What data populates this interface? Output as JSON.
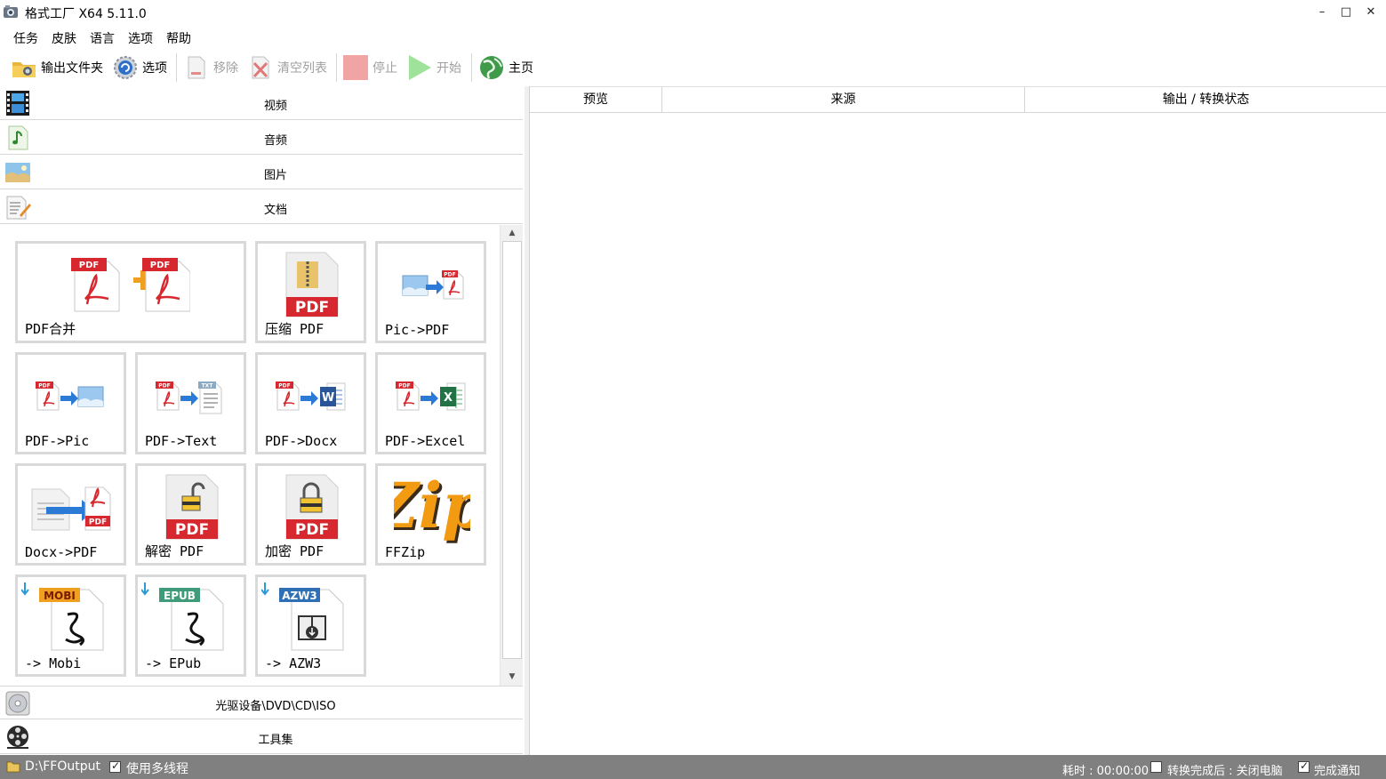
{
  "window": {
    "title": "格式工厂 X64 5.11.0"
  },
  "menu": [
    "任务",
    "皮肤",
    "语言",
    "选项",
    "帮助"
  ],
  "toolbar": {
    "output_folder": "输出文件夹",
    "options": "选项",
    "remove": "移除",
    "clear_list": "清空列表",
    "stop": "停止",
    "start": "开始",
    "home": "主页"
  },
  "categories": {
    "video": "视频",
    "audio": "音频",
    "picture": "图片",
    "document": "文档",
    "rom": "光驱设备\\DVD\\CD\\ISO",
    "tools": "工具集"
  },
  "tiles": {
    "pdf_merge": "PDF合并",
    "pdf_compress": "压缩 PDF",
    "pic_to_pdf": "Pic->PDF",
    "pdf_to_pic": "PDF->Pic",
    "pdf_to_text": "PDF->Text",
    "pdf_to_docx": "PDF->Docx",
    "pdf_to_excel": "PDF->Excel",
    "docx_to_pdf": "Docx->PDF",
    "pdf_decrypt": "解密 PDF",
    "pdf_encrypt": "加密 PDF",
    "ffzip": "FFZip",
    "to_mobi": "-> Mobi",
    "to_epub": "-> EPub",
    "to_azw3": "-> AZW3"
  },
  "art_text": {
    "pdf": "PDF",
    "txt": "TXT",
    "word": "W",
    "excel": "X",
    "zip": "Zip",
    "mobi": "MOBI",
    "epub": "EPUB",
    "azw3": "AZW3"
  },
  "columns": {
    "preview": "预览",
    "source": "来源",
    "status": "输出 / 转换状态"
  },
  "statusbar": {
    "output_path": "D:\\FFOutput",
    "multithread": "使用多线程",
    "elapsed": "耗时 : 00:00:00",
    "after_done": "转换完成后 : 关闭电脑",
    "notify": "完成通知"
  },
  "colors": {
    "pdf_red": "#d7282f",
    "accent_blue": "#2b7bd6",
    "status_gray": "#808080"
  }
}
